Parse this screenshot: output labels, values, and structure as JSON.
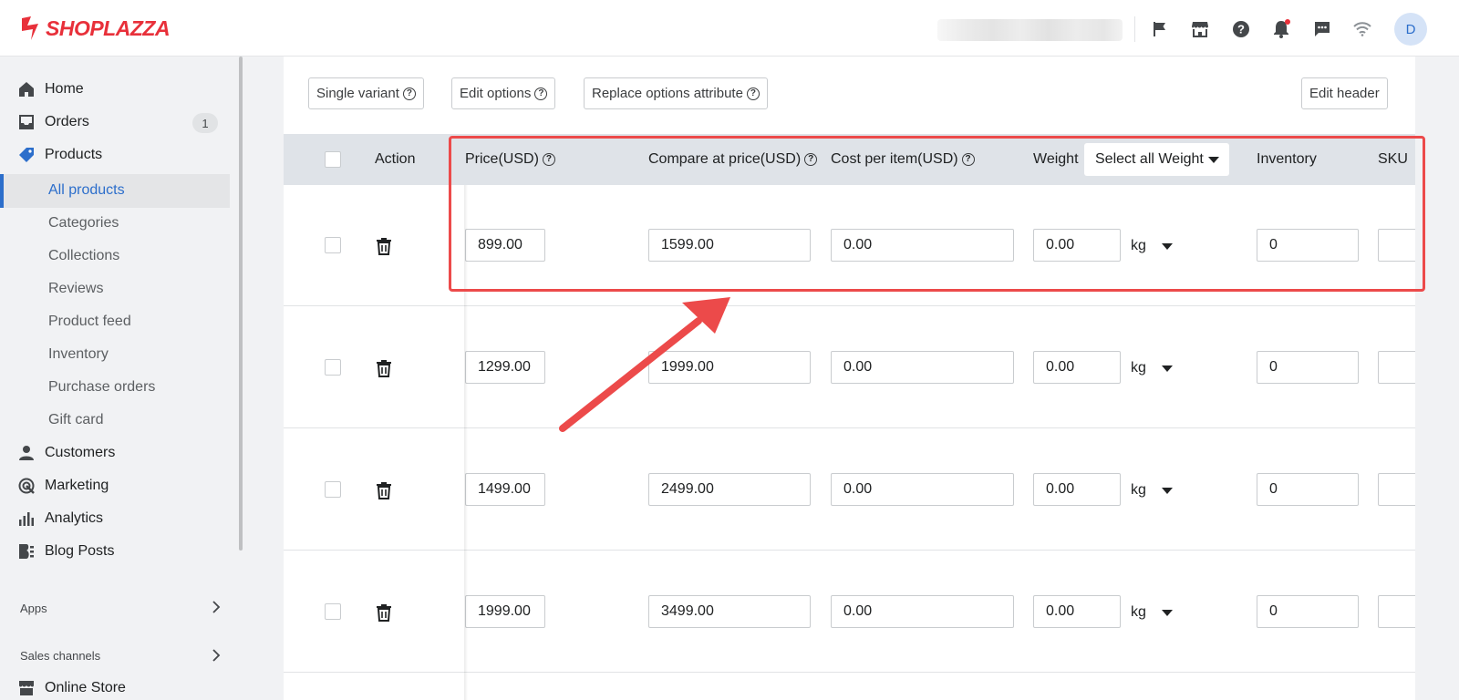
{
  "brand": {
    "name": "SHOPLAZZA",
    "color": "#e8303a"
  },
  "header": {
    "icons": [
      "flag-icon",
      "storefront-icon",
      "help-icon",
      "bell-icon",
      "chat-icon",
      "wifi-icon"
    ],
    "avatar_initial": "D"
  },
  "sidebar": {
    "items": [
      {
        "label": "Home",
        "icon": "home-icon"
      },
      {
        "label": "Orders",
        "icon": "inbox-icon",
        "badge": "1"
      },
      {
        "label": "Products",
        "icon": "tag-icon"
      },
      {
        "label": "Customers",
        "icon": "person-icon"
      },
      {
        "label": "Marketing",
        "icon": "target-icon"
      },
      {
        "label": "Analytics",
        "icon": "bar-chart-icon"
      },
      {
        "label": "Blog Posts",
        "icon": "blog-icon"
      }
    ],
    "product_subitems": [
      "All products",
      "Categories",
      "Collections",
      "Reviews",
      "Product feed",
      "Inventory",
      "Purchase orders",
      "Gift card"
    ],
    "active_subitem": "All products",
    "apps_label": "Apps",
    "sales_channels_label": "Sales channels",
    "online_store_label": "Online Store"
  },
  "toolbar": {
    "single_variant": "Single variant",
    "edit_options": "Edit options",
    "replace_options": "Replace options attribute",
    "edit_header": "Edit header"
  },
  "table": {
    "headers": {
      "action": "Action",
      "price": "Price(USD)",
      "compare": "Compare at price(USD)",
      "cost": "Cost per item(USD)",
      "weight": "Weight",
      "weight_select": "Select all Weight",
      "inventory": "Inventory",
      "sku": "SKU"
    },
    "rows": [
      {
        "price": "899.00",
        "compare": "1599.00",
        "cost": "0.00",
        "weight": "0.00",
        "unit": "kg",
        "inventory": "0"
      },
      {
        "price": "1299.00",
        "compare": "1999.00",
        "cost": "0.00",
        "weight": "0.00",
        "unit": "kg",
        "inventory": "0"
      },
      {
        "price": "1499.00",
        "compare": "2499.00",
        "cost": "0.00",
        "weight": "0.00",
        "unit": "kg",
        "inventory": "0"
      },
      {
        "price": "1999.00",
        "compare": "3499.00",
        "cost": "0.00",
        "weight": "0.00",
        "unit": "kg",
        "inventory": "0"
      }
    ]
  },
  "annotation": {
    "color": "#ec4a4a"
  },
  "accent_color": "#2c6ecb"
}
